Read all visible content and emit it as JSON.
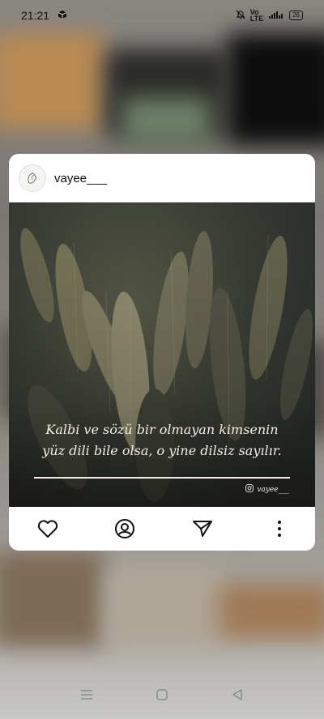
{
  "status_bar": {
    "time": "21:21",
    "battery": "26",
    "icons": [
      "cube-icon",
      "mute-bell-icon",
      "volte-icon",
      "signal-icon",
      "battery-icon"
    ]
  },
  "post": {
    "username": "vayee___",
    "quote_line1": "Kalbi ve sözü bir olmayan kimsenin",
    "quote_line2": "yüz dili bile olsa, o yine dilsiz sayılır.",
    "watermark_handle": "vayee___"
  },
  "actions": [
    "heart-icon",
    "profile-icon",
    "send-icon",
    "more-vertical-icon"
  ],
  "navigation": [
    "menu-icon",
    "home-icon",
    "back-icon"
  ],
  "colors": {
    "quote_text": "#f3efe6",
    "card_bg": "#ffffff"
  }
}
